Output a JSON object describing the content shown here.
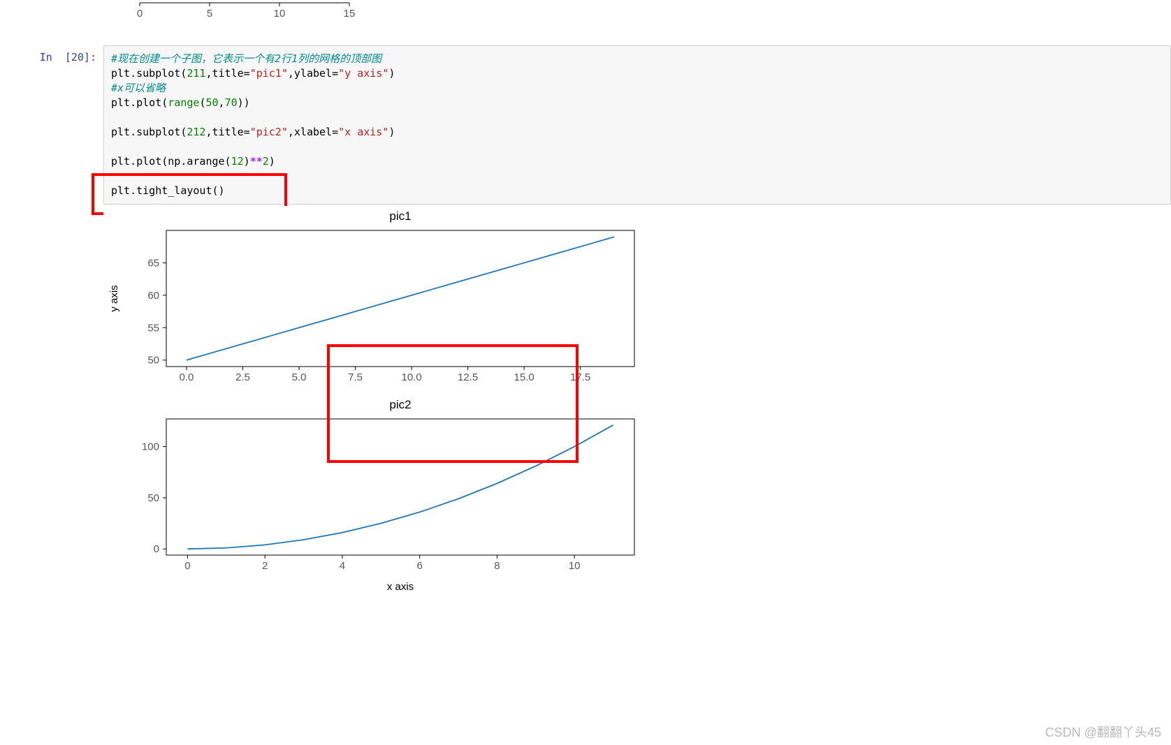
{
  "top_axis_fragment": {
    "ticks": [
      0,
      5,
      10,
      15
    ]
  },
  "prompt": {
    "label": "In",
    "number": "[20]:"
  },
  "code": {
    "line1_comment": "#现在创建一个子图，它表示一个有2行1列的网格的顶部图",
    "line2_a": "plt.subplot(",
    "line2_b": "211",
    "line2_c": ",title=",
    "line2_d": "\"pic1\"",
    "line2_e": ",ylabel=",
    "line2_f": "\"y axis\"",
    "line2_g": ")",
    "line3_comment": "#x可以省略",
    "line4_a": "plt.plot(",
    "line4_b": "range",
    "line4_c": "(",
    "line4_d": "50",
    "line4_e": ",",
    "line4_f": "70",
    "line4_g": "))",
    "line6_a": "plt.subplot(",
    "line6_b": "212",
    "line6_c": ",title=",
    "line6_d": "\"pic2\"",
    "line6_e": ",xlabel=",
    "line6_f": "\"x axis\"",
    "line6_g": ")",
    "line8_a": "plt.plot(np.arange(",
    "line8_b": "12",
    "line8_c": ")",
    "line8_op": "**",
    "line8_d": "2",
    "line8_e": ")",
    "line10": "plt.tight_layout()"
  },
  "watermark": "CSDN @翻翻丫头45",
  "chart_data": [
    {
      "type": "line",
      "title": "pic1",
      "ylabel": "y axis",
      "xlabel": "",
      "x": [
        0,
        1,
        2,
        3,
        4,
        5,
        6,
        7,
        8,
        9,
        10,
        11,
        12,
        13,
        14,
        15,
        16,
        17,
        18,
        19
      ],
      "y": [
        50,
        51,
        52,
        53,
        54,
        55,
        56,
        57,
        58,
        59,
        60,
        61,
        62,
        63,
        64,
        65,
        66,
        67,
        68,
        69
      ],
      "xlim": [
        -0.9,
        19.9
      ],
      "ylim": [
        49,
        70
      ],
      "xticks": [
        0.0,
        2.5,
        5.0,
        7.5,
        10.0,
        12.5,
        15.0,
        17.5
      ],
      "yticks": [
        50,
        55,
        60,
        65
      ]
    },
    {
      "type": "line",
      "title": "pic2",
      "ylabel": "",
      "xlabel": "x axis",
      "x": [
        0,
        1,
        2,
        3,
        4,
        5,
        6,
        7,
        8,
        9,
        10,
        11
      ],
      "y": [
        0,
        1,
        4,
        9,
        16,
        25,
        36,
        49,
        64,
        81,
        100,
        121
      ],
      "xlim": [
        -0.55,
        11.55
      ],
      "ylim": [
        -6,
        127
      ],
      "xticks": [
        0,
        2,
        4,
        6,
        8,
        10
      ],
      "yticks": [
        0,
        50,
        100
      ]
    }
  ]
}
